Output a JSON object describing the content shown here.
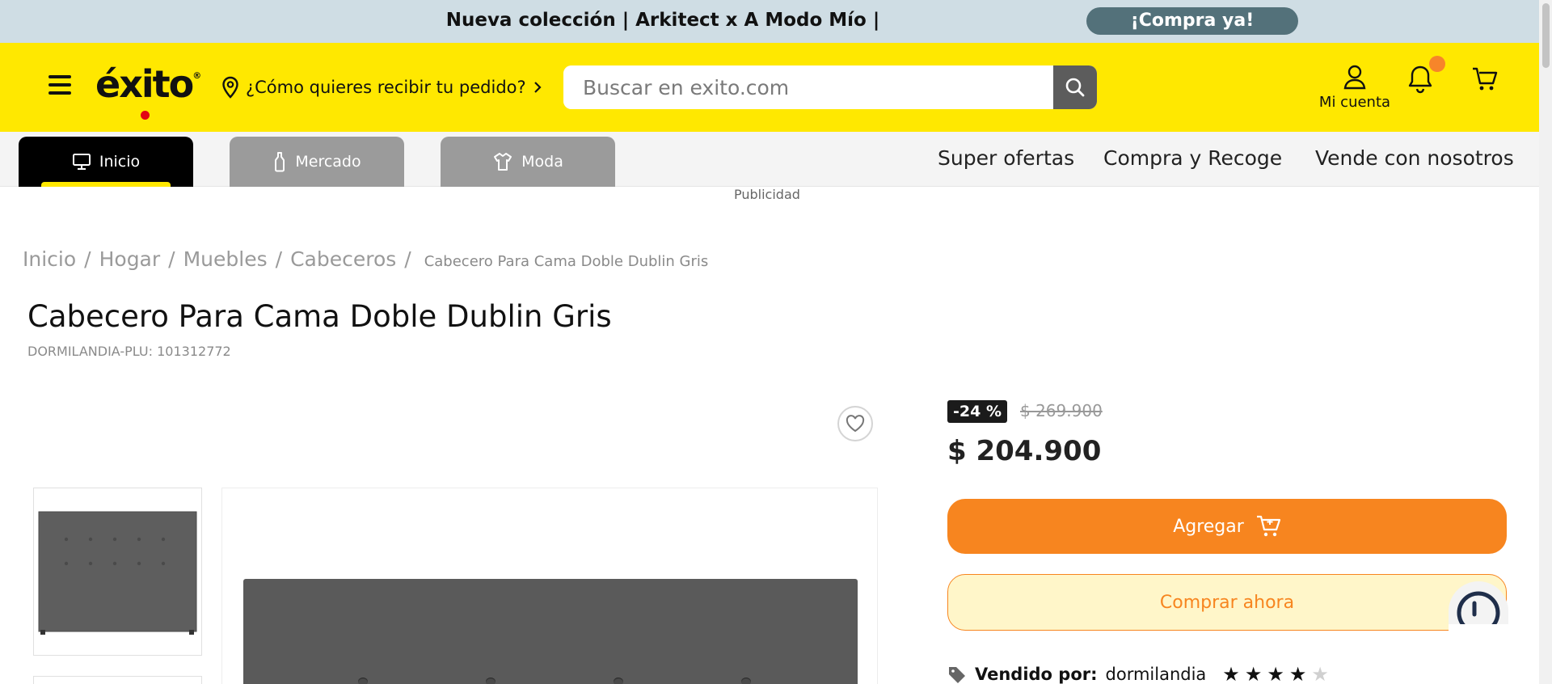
{
  "promo": {
    "text": "Nueva colección | Arkitect x A Modo Mío |",
    "button": "¡Compra ya!"
  },
  "header": {
    "logo_text": "éxito",
    "logo_mark": "®",
    "delivery_text": "¿Cómo quieres recibir tu pedido?",
    "search_placeholder": "Buscar en exito.com",
    "account_label": "Mi cuenta"
  },
  "nav": {
    "tabs": [
      {
        "label": "Inicio",
        "icon": "monitor-icon",
        "active": true
      },
      {
        "label": "Mercado",
        "icon": "bottle-icon",
        "active": false
      },
      {
        "label": "Moda",
        "icon": "shirt-icon",
        "active": false
      }
    ],
    "links": [
      "Super ofertas",
      "Compra y Recoge",
      "Vende con nosotros"
    ]
  },
  "ad_label": "Publicidad",
  "breadcrumb": {
    "items": [
      "Inicio",
      "Hogar",
      "Muebles",
      "Cabeceros"
    ],
    "separator": "/",
    "current": "Cabecero Para Cama Doble Dublin Gris"
  },
  "product": {
    "title": "Cabecero Para Cama Doble Dublin Gris",
    "plu": "DORMILANDIA-PLU: 101312772",
    "discount": "-24 %",
    "old_price": "$ 269.900",
    "price": "$ 204.900",
    "add_label": "Agregar",
    "buy_label": "Comprar ahora",
    "seller_label": "Vendido por:",
    "seller_name": "dormilandia",
    "rating": 4,
    "rating_max": 5
  },
  "colors": {
    "brand_yellow": "#ffe800",
    "accent_orange": "#f7851f",
    "promo_bg": "#cfdde4",
    "promo_button": "#53717a"
  }
}
